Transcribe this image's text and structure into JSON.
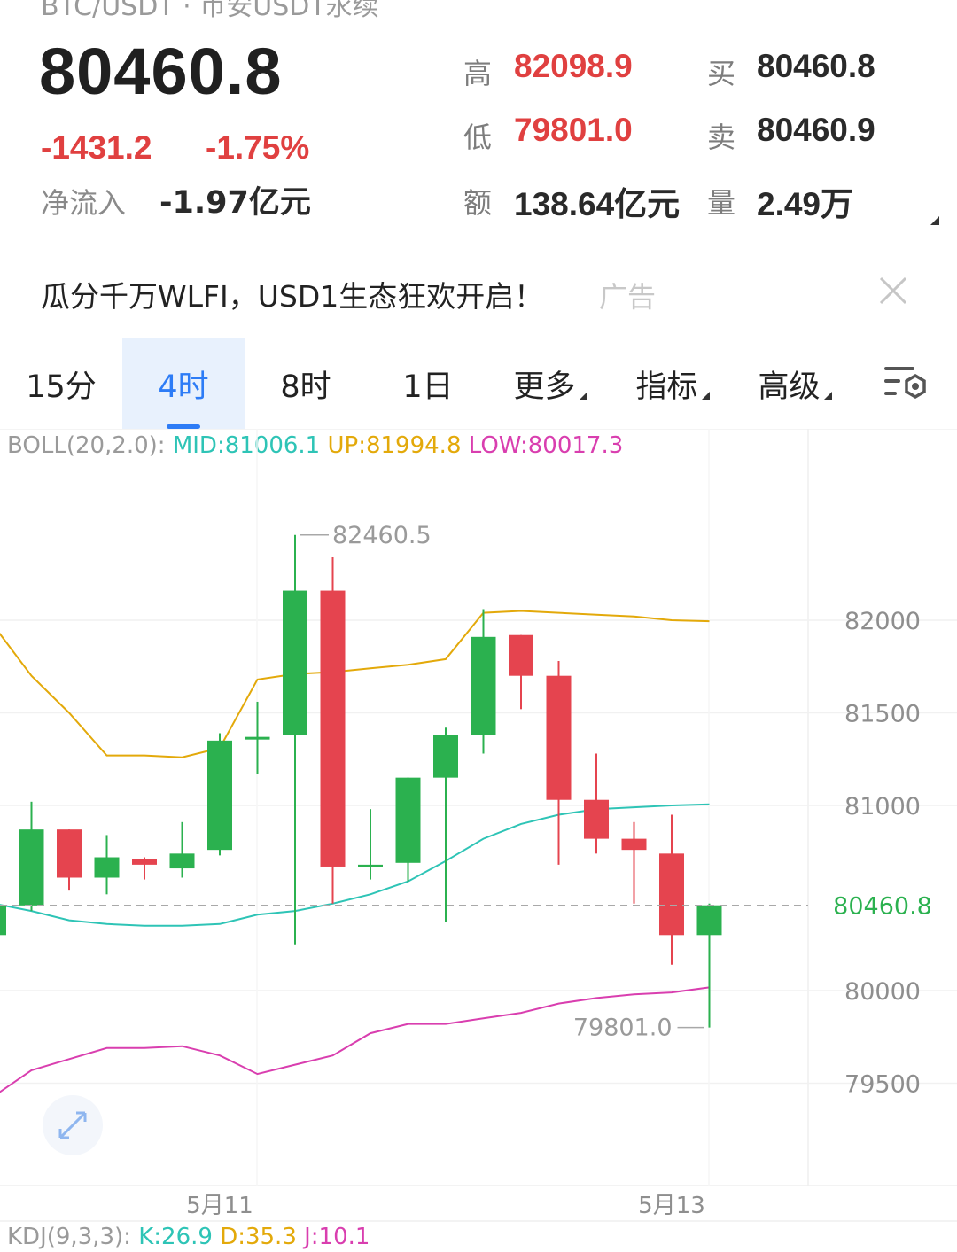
{
  "header": {
    "pair_partial": "BTC/USDT · 币安USDT永续",
    "price": "80460.8",
    "change_abs": "-1431.2",
    "change_pct": "-1.75%",
    "netflow_label": "净流入",
    "netflow_value": "-1.97亿元"
  },
  "stats": {
    "high_label": "高",
    "high_value": "82098.9",
    "low_label": "低",
    "low_value": "79801.0",
    "amount_label": "额",
    "amount_value": "138.64亿元",
    "bid_label": "买",
    "bid_value": "80460.8",
    "ask_label": "卖",
    "ask_value": "80460.9",
    "volume_label": "量",
    "volume_value": "2.49万"
  },
  "ad": {
    "text": "瓜分千万WLFI，USD1生态狂欢开启！",
    "tag": "广告",
    "close_icon": "close-icon"
  },
  "tabs": {
    "t15m": "15分",
    "t4h": "4时",
    "t8h": "8时",
    "t1d": "1日",
    "more": "更多",
    "indicator": "指标",
    "advanced": "高级",
    "settings_icon": "chart-settings-icon",
    "active": "4时"
  },
  "boll": {
    "name": "BOLL(20,2.0):",
    "mid": "MID:81006.1",
    "up": "UP:81994.8",
    "low": "LOW:80017.3"
  },
  "kdj": {
    "name": "KDJ(9,3,3):",
    "k": "K:26.9",
    "d": "D:35.3",
    "j": "J:10.1"
  },
  "colors": {
    "up": "#2bb14f",
    "down": "#e5444f",
    "mid_band": "#2ec4b6",
    "up_band": "#e3a90a",
    "low_band": "#d93eaf",
    "accent": "#2d7cf6"
  },
  "chart_data": {
    "type": "candlestick",
    "y_ticks": [
      82000,
      81500,
      81000,
      80000,
      79500
    ],
    "ylim": [
      79300,
      82850
    ],
    "current_price": 80460.8,
    "current_price_label": "80460.8",
    "max_label": "82460.5",
    "min_label": "79801.0",
    "x_labels": [
      "5月11",
      "5月13"
    ],
    "x_label_slots": [
      6,
      18
    ],
    "candles": [
      {
        "o": 80300,
        "c": 80460,
        "h": 80480,
        "l": 80280
      },
      {
        "o": 80460,
        "c": 80870,
        "h": 81020,
        "l": 80430
      },
      {
        "o": 80870,
        "c": 80610,
        "h": 80870,
        "l": 80540
      },
      {
        "o": 80610,
        "c": 80720,
        "h": 80840,
        "l": 80520
      },
      {
        "o": 80710,
        "c": 80680,
        "h": 80720,
        "l": 80600
      },
      {
        "o": 80660,
        "c": 80740,
        "h": 80910,
        "l": 80610
      },
      {
        "o": 80760,
        "c": 81350,
        "h": 81390,
        "l": 80730
      },
      {
        "o": 81360,
        "c": 81370,
        "h": 81560,
        "l": 81170
      },
      {
        "o": 81380,
        "c": 82160,
        "h": 82460.5,
        "l": 80250
      },
      {
        "o": 82160,
        "c": 80670,
        "h": 82340,
        "l": 80470
      },
      {
        "o": 80670,
        "c": 80680,
        "h": 80980,
        "l": 80600
      },
      {
        "o": 80690,
        "c": 81150,
        "h": 81150,
        "l": 80590
      },
      {
        "o": 81150,
        "c": 81380,
        "h": 81420,
        "l": 80370
      },
      {
        "o": 81380,
        "c": 81910,
        "h": 82060,
        "l": 81280
      },
      {
        "o": 81920,
        "c": 81700,
        "h": 81920,
        "l": 81520
      },
      {
        "o": 81700,
        "c": 81030,
        "h": 81780,
        "l": 80680
      },
      {
        "o": 81030,
        "c": 80820,
        "h": 81280,
        "l": 80740
      },
      {
        "o": 80820,
        "c": 80760,
        "h": 80910,
        "l": 80470
      },
      {
        "o": 80740,
        "c": 80300,
        "h": 80950,
        "l": 80140
      },
      {
        "o": 80300,
        "c": 80460.8,
        "h": 80470,
        "l": 79801.0
      }
    ],
    "boll_up": [
      81970,
      81700,
      81500,
      81270,
      81270,
      81260,
      81310,
      81680,
      81710,
      81720,
      81740,
      81760,
      81790,
      82040,
      82050,
      82040,
      82030,
      82020,
      82000,
      81994.8
    ],
    "boll_mid": [
      80470,
      80430,
      80380,
      80360,
      80350,
      80350,
      80360,
      80410,
      80430,
      80470,
      80520,
      80590,
      80700,
      80820,
      80900,
      80950,
      80980,
      80990,
      81000,
      81006.1
    ],
    "boll_low": [
      79430,
      79570,
      79630,
      79690,
      79690,
      79700,
      79650,
      79550,
      79600,
      79650,
      79770,
      79820,
      79820,
      79850,
      79880,
      79930,
      79960,
      79980,
      79990,
      80017.3
    ]
  }
}
